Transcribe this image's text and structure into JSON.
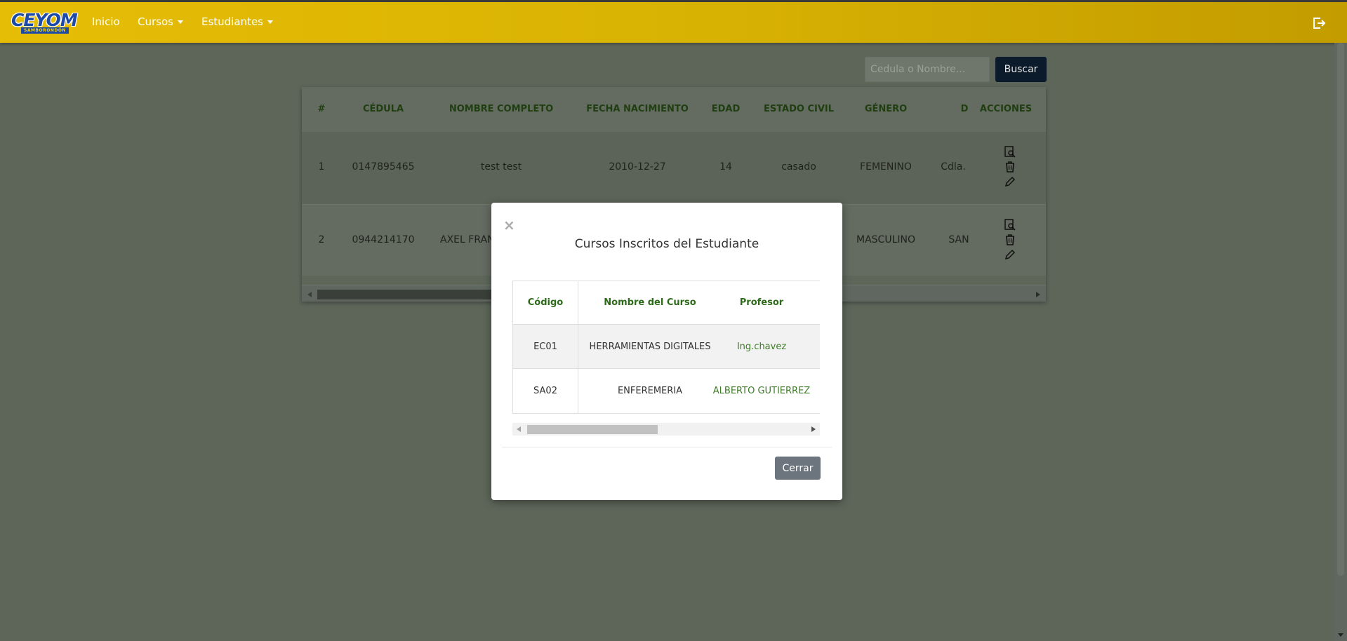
{
  "navbar": {
    "logo_text": "CEYOM",
    "logo_subtext": "SAMBORONDÓN",
    "inicio": "Inicio",
    "cursos": "Cursos",
    "estudiantes": "Estudiantes",
    "background_color": "#d9b303"
  },
  "search": {
    "placeholder": "Cedula o Nombre...",
    "button": "Buscar"
  },
  "table": {
    "headers": [
      "#",
      "CÉDULA",
      "NOMBRE COMPLETO",
      "FECHA NACIMIENTO",
      "EDAD",
      "ESTADO CIVIL",
      "GÉNERO",
      "D",
      "ACCIONES"
    ],
    "rows": [
      [
        "1",
        "0147895465",
        "test test",
        "2010-12-27",
        "14",
        "casado",
        "FEMENINO",
        "Cdla."
      ],
      [
        "2",
        "0944214170",
        "AXEL FRANC",
        "",
        "",
        "",
        "MASCULINO",
        "SAN"
      ]
    ],
    "header_color": "#1f3f10"
  },
  "modal": {
    "close": "×",
    "title": "Cursos Inscritos del Estudiante",
    "headers": [
      "Código",
      "Nombre del Curso",
      "Profesor"
    ],
    "rows": [
      {
        "codigo": "EC01",
        "nombre": "HERRAMIENTAS DIGITALES",
        "profesor": "Ing.chavez"
      },
      {
        "codigo": "SA02",
        "nombre": "ENFEREMERIA",
        "profesor": "ALBERTO GUTIERREZ"
      }
    ],
    "close_button": "Cerrar",
    "header_color": "#2d6b1b"
  }
}
